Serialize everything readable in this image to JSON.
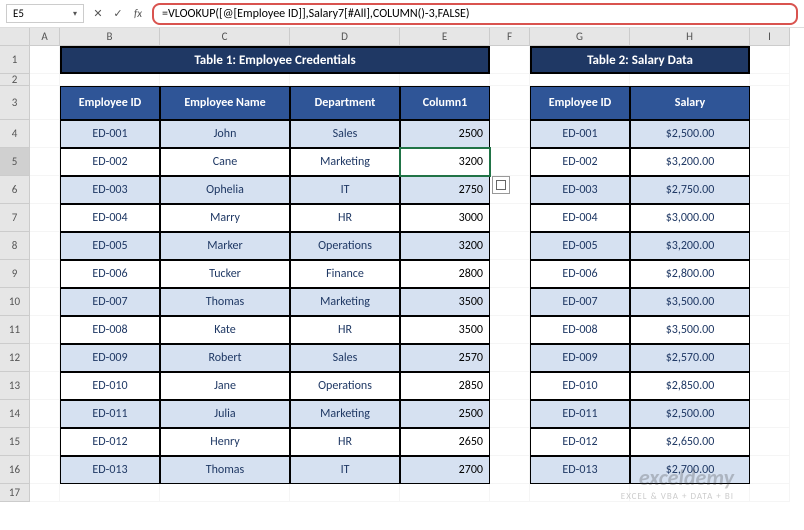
{
  "namebox": "E5",
  "formula": "=VLOOKUP([@[Employee ID]],Salary7[#All],COLUMN()-3,FALSE)",
  "columns": [
    "A",
    "B",
    "C",
    "D",
    "E",
    "F",
    "G",
    "H",
    "I"
  ],
  "table1": {
    "title": "Table 1: Employee Credentials",
    "headers": [
      "Employee ID",
      "Employee Name",
      "Department",
      "Column1"
    ],
    "rows": [
      {
        "id": "ED-001",
        "name": "John",
        "dept": "Sales",
        "val": "2500"
      },
      {
        "id": "ED-002",
        "name": "Cane",
        "dept": "Marketing",
        "val": "3200"
      },
      {
        "id": "ED-003",
        "name": "Ophelia",
        "dept": "IT",
        "val": "2750"
      },
      {
        "id": "ED-004",
        "name": "Marry",
        "dept": "HR",
        "val": "3000"
      },
      {
        "id": "ED-005",
        "name": "Marker",
        "dept": "Operations",
        "val": "3200"
      },
      {
        "id": "ED-006",
        "name": "Tucker",
        "dept": "Finance",
        "val": "2800"
      },
      {
        "id": "ED-007",
        "name": "Thomas",
        "dept": "Marketing",
        "val": "3500"
      },
      {
        "id": "ED-008",
        "name": "Kate",
        "dept": "HR",
        "val": "3500"
      },
      {
        "id": "ED-009",
        "name": "Robert",
        "dept": "Sales",
        "val": "2570"
      },
      {
        "id": "ED-010",
        "name": "Jane",
        "dept": "Operations",
        "val": "2850"
      },
      {
        "id": "ED-011",
        "name": "Julia",
        "dept": "Marketing",
        "val": "2500"
      },
      {
        "id": "ED-012",
        "name": "Henry",
        "dept": "HR",
        "val": "2650"
      },
      {
        "id": "ED-013",
        "name": "Thomas",
        "dept": "IT",
        "val": "2700"
      }
    ]
  },
  "table2": {
    "title": "Table 2: Salary Data",
    "headers": [
      "Employee ID",
      "Salary"
    ],
    "rows": [
      {
        "id": "ED-001",
        "sal": "$2,500.00"
      },
      {
        "id": "ED-002",
        "sal": "$3,200.00"
      },
      {
        "id": "ED-003",
        "sal": "$2,750.00"
      },
      {
        "id": "ED-004",
        "sal": "$3,000.00"
      },
      {
        "id": "ED-005",
        "sal": "$3,200.00"
      },
      {
        "id": "ED-006",
        "sal": "$2,800.00"
      },
      {
        "id": "ED-007",
        "sal": "$3,500.00"
      },
      {
        "id": "ED-008",
        "sal": "$3,500.00"
      },
      {
        "id": "ED-009",
        "sal": "$2,570.00"
      },
      {
        "id": "ED-010",
        "sal": "$2,850.00"
      },
      {
        "id": "ED-011",
        "sal": "$2,500.00"
      },
      {
        "id": "ED-012",
        "sal": "$2,650.00"
      },
      {
        "id": "ED-013",
        "sal": "$2,700.00"
      }
    ]
  },
  "watermark": {
    "title": "exceldemy",
    "sub": "EXCEL & VBA + DATA + BI"
  }
}
